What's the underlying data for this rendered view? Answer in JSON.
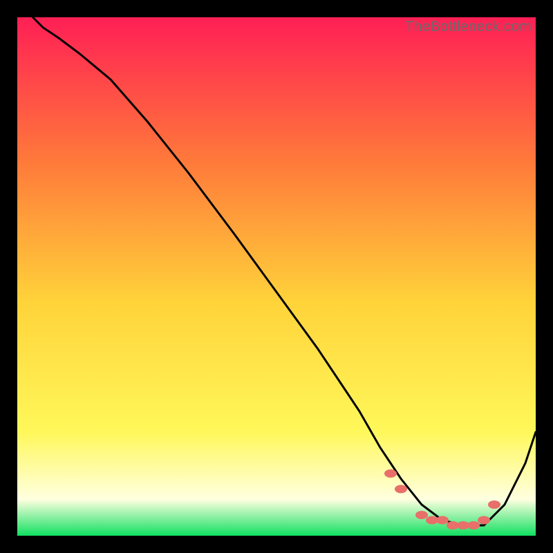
{
  "watermark": "TheBottleneck.com",
  "colors": {
    "gradient_top": "#ff1f55",
    "gradient_mid_upper": "#ff7a3a",
    "gradient_mid": "#ffd33a",
    "gradient_lower": "#fff85a",
    "gradient_pale": "#ffffe0",
    "gradient_bottom": "#10e060",
    "curve": "#000000",
    "marker": "#e86f6a"
  },
  "chart_data": {
    "type": "line",
    "title": "",
    "xlabel": "",
    "ylabel": "",
    "xlim": [
      0,
      100
    ],
    "ylim": [
      0,
      100
    ],
    "series": [
      {
        "name": "curve",
        "x": [
          3,
          5,
          8,
          12,
          18,
          25,
          33,
          42,
          50,
          58,
          62,
          66,
          70,
          74,
          78,
          82,
          86,
          90,
          94,
          98,
          100
        ],
        "y": [
          100,
          98,
          96,
          93,
          88,
          80,
          70,
          58,
          47,
          36,
          30,
          24,
          17,
          11,
          6,
          3,
          2,
          2,
          6,
          14,
          20
        ]
      }
    ],
    "markers": {
      "name": "highlight-points",
      "x": [
        72,
        74,
        78,
        80,
        82,
        84,
        86,
        88,
        90,
        92
      ],
      "y": [
        12,
        9,
        4,
        3,
        3,
        2,
        2,
        2,
        3,
        6
      ]
    },
    "note": "Axis values are estimated from pixel positions; the chart has no visible numeric tick labels."
  }
}
